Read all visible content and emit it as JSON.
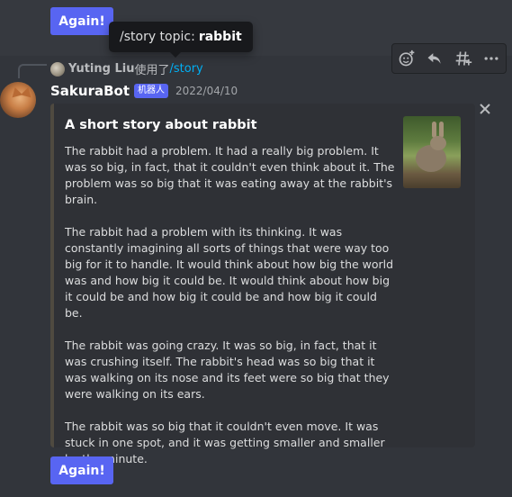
{
  "top_button": {
    "label": "Again!"
  },
  "tooltip": {
    "prefix": "/story topic:",
    "value": "rabbit"
  },
  "toolbar": {
    "icons": [
      "add-reaction-icon",
      "reply-icon",
      "create-thread-icon",
      "more-icon"
    ]
  },
  "reply": {
    "user": "Yuting Liu",
    "used_text": "使用了",
    "command": "/story"
  },
  "message": {
    "username": "SakuraBot",
    "bot_tag": "机器人",
    "timestamp": "2022/04/10"
  },
  "embed": {
    "title": "A short story about rabbit",
    "paragraphs": [
      "The rabbit had a problem. It had a really big problem. It was so big, in fact, that it couldn't even think about it. The problem was so big that it was eating away at the rabbit's brain.",
      "The rabbit had a problem with its thinking. It was constantly imagining all sorts of things that were way too big for it to handle. It would think about how big the world was and how big it could be. It would think about how big it could be and how big it could be and how big it could be.",
      "The rabbit was going crazy. It was so big, in fact, that it was crushing itself. The rabbit's head was so big that it was walking on its nose and its feet were so big that they were walking on its ears.",
      "The rabbit was so big that it couldn't even move. It was stuck in one spot, and it was getting smaller and smaller by the minute."
    ],
    "thumbnail_icon": "rabbit-photo",
    "border_color": "#4f4a40"
  },
  "bottom_button": {
    "label": "Again!"
  },
  "colors": {
    "background": "#36393f",
    "embed_bg": "#2f3136",
    "blurple": "#5865f2",
    "link": "#00aff4"
  }
}
